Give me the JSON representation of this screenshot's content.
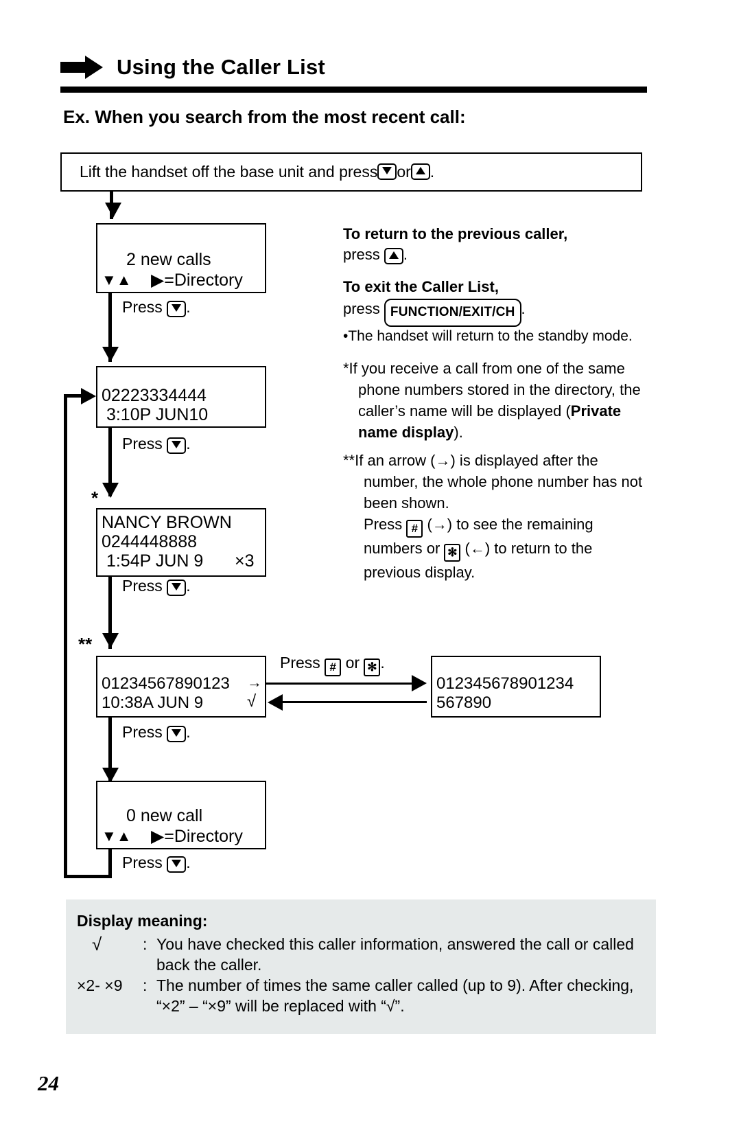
{
  "header": {
    "arrow_icon": "right-arrow-icon",
    "title": "Using the Caller List"
  },
  "subheading": "Ex. When you search from the most recent call:",
  "step_instruction": {
    "text_before": "Lift the handset off the base unit and press ",
    "key_down": "▼",
    "text_mid": " or ",
    "key_up": "▲",
    "text_after": "."
  },
  "flow": {
    "press_label": "Press ",
    "press_label_end": ".",
    "boxes": [
      {
        "name": "new-calls-display",
        "lines": [
          "    2 new calls",
          "▼▲    ▶=Directory"
        ],
        "line1": "2 new calls",
        "line2_left": "▼▲",
        "line2_right": "▶=Directory"
      },
      {
        "name": "caller-1-display",
        "line1": "02223334444",
        "line2": " 3:10P JUN10",
        "marker": ""
      },
      {
        "name": "caller-2-display",
        "line1": "NANCY BROWN",
        "line2": "0244448888",
        "line3_left": " 1:54P JUN 9",
        "line3_right": "×3",
        "marker": "*"
      },
      {
        "name": "caller-3-display",
        "line1_left": "01234567890123",
        "line1_right": "→",
        "line2_left": "10:38A JUN 9",
        "line2_right": "√",
        "marker": "**"
      },
      {
        "name": "zero-new-call-display",
        "line1": "0 new call",
        "line2_left": "▼▲",
        "line2_right": "▶=Directory"
      }
    ],
    "expanded_box": {
      "name": "expanded-number-display",
      "line1": "012345678901234",
      "line2": "567890"
    },
    "toggle_label": {
      "before": "Press ",
      "hash": "#",
      "mid": " or ",
      "star": "✻",
      "after": "."
    }
  },
  "notes": {
    "prev_caller_title": "To return to the previous caller,",
    "prev_caller_press": "press ",
    "prev_caller_key": "▲",
    "prev_caller_end": ".",
    "exit_title": "To exit the Caller List,",
    "exit_press": "press ",
    "exit_key": "FUNCTION/EXIT/CH",
    "exit_end": ".",
    "bullet_standby": "•The handset will return to the standby mode.",
    "note_star_pre": "*If you receive a call from one of the same phone numbers stored in the directory, the caller’s name will be displayed (",
    "note_star_bold": "Private name display",
    "note_star_post": ").",
    "note_2star_line1": "**If an arrow (→) is displayed after the number, the whole phone number has not been shown.",
    "note_2star_line2_a": "Press ",
    "note_2star_key_hash": "#",
    "note_2star_line2_b": " (→) to see the remaining numbers or ",
    "note_2star_key_star": "✻",
    "note_2star_line2_c": " (←) to return to the previous display."
  },
  "display_meaning": {
    "title": "Display meaning:",
    "rows": [
      {
        "symbol": "√",
        "colon": ":",
        "text": "You have checked this caller information, answered the call or called back the caller."
      },
      {
        "symbol": "×2- ×9",
        "colon": ":",
        "text": "The number of times the same caller called (up to 9). After checking, “×2” – “×9” will be replaced with “√”."
      }
    ]
  },
  "page_number": "24",
  "colors": {
    "ink": "#000000",
    "panel_bg": "#e6eaea",
    "page_bg": "#ffffff"
  }
}
